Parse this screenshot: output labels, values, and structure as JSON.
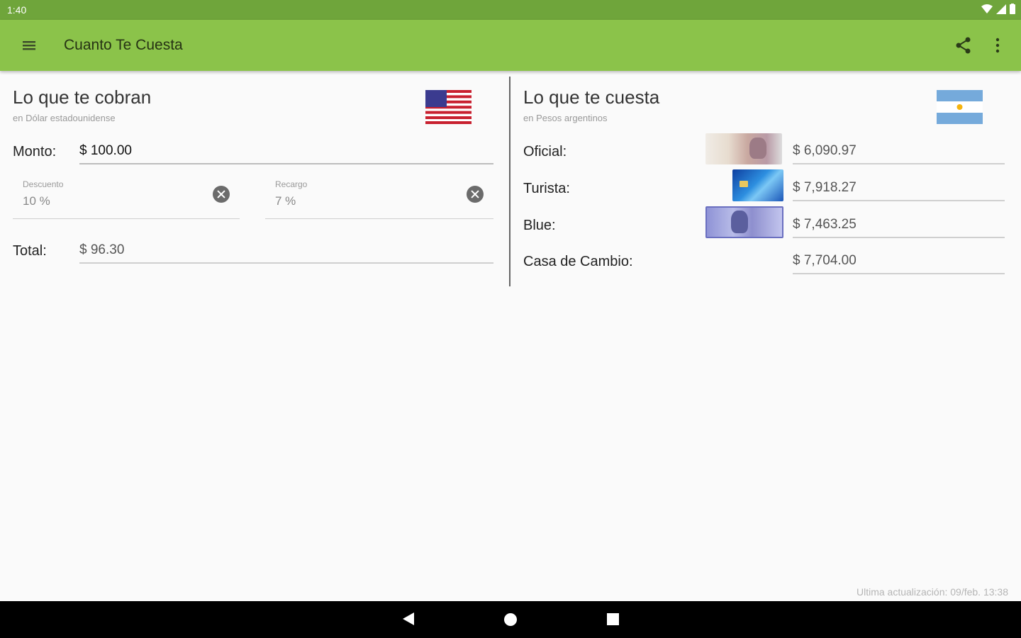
{
  "status_bar": {
    "time": "1:40"
  },
  "app_bar": {
    "title": "Cuanto Te Cuesta"
  },
  "left": {
    "title": "Lo que te cobran",
    "subtitle": "en Dólar estadounidense",
    "monto_label": "Monto:",
    "monto_value": "$ 100.00",
    "descuento_label": "Descuento",
    "descuento_value": "10 %",
    "recargo_label": "Recargo",
    "recargo_value": "7 %",
    "total_label": "Total:",
    "total_value": "$ 96.30"
  },
  "right": {
    "title": "Lo que te cuesta",
    "subtitle": "en Pesos argentinos",
    "rates": [
      {
        "label": "Oficial:",
        "value": "$ 6,090.97"
      },
      {
        "label": "Turista:",
        "value": "$ 7,918.27"
      },
      {
        "label": "Blue:",
        "value": "$ 7,463.25"
      },
      {
        "label": "Casa de Cambio:",
        "value": "$ 7,704.00"
      }
    ]
  },
  "footer": {
    "last_update": "Ultima actualización: 09/feb. 13:38"
  },
  "colors": {
    "status_bar": "#6fa53b",
    "app_bar": "#8bc34a",
    "background": "#fafafa"
  }
}
